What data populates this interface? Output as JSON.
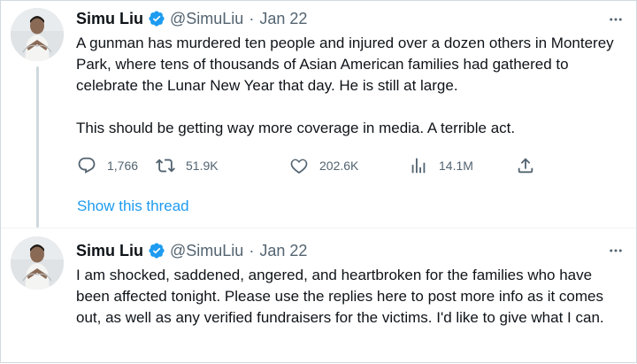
{
  "colors": {
    "accent": "#1d9bf0",
    "text": "#0f1419",
    "muted": "#536471",
    "divider": "#cfd9de"
  },
  "tweets": [
    {
      "author": {
        "name": "Simu Liu",
        "handle": "@SimuLiu",
        "verified": true
      },
      "separator": "·",
      "date": "Jan 22",
      "paragraphs": [
        "A gunman has murdered ten people and injured over a dozen others in Monterey Park, where tens of thousands of Asian American families had gathered to celebrate the Lunar New Year that day. He is still at large.",
        "This should be getting way more coverage in media. A terrible act."
      ],
      "metrics": {
        "replies": "1,766",
        "retweets": "51.9K",
        "likes": "202.6K",
        "views": "14.1M"
      },
      "icons": [
        "reply-icon",
        "retweet-icon",
        "like-icon",
        "views-icon",
        "share-icon",
        "more-icon",
        "verified-icon"
      ],
      "show_thread_label": "Show this thread"
    },
    {
      "author": {
        "name": "Simu Liu",
        "handle": "@SimuLiu",
        "verified": true
      },
      "separator": "·",
      "date": "Jan 22",
      "paragraphs": [
        "I am shocked, saddened, angered, and heartbroken for the families who have been affected tonight. Please use the replies here to post more info as it comes out, as well as any verified fundraisers for the victims. I'd like to give what I can."
      ]
    }
  ]
}
